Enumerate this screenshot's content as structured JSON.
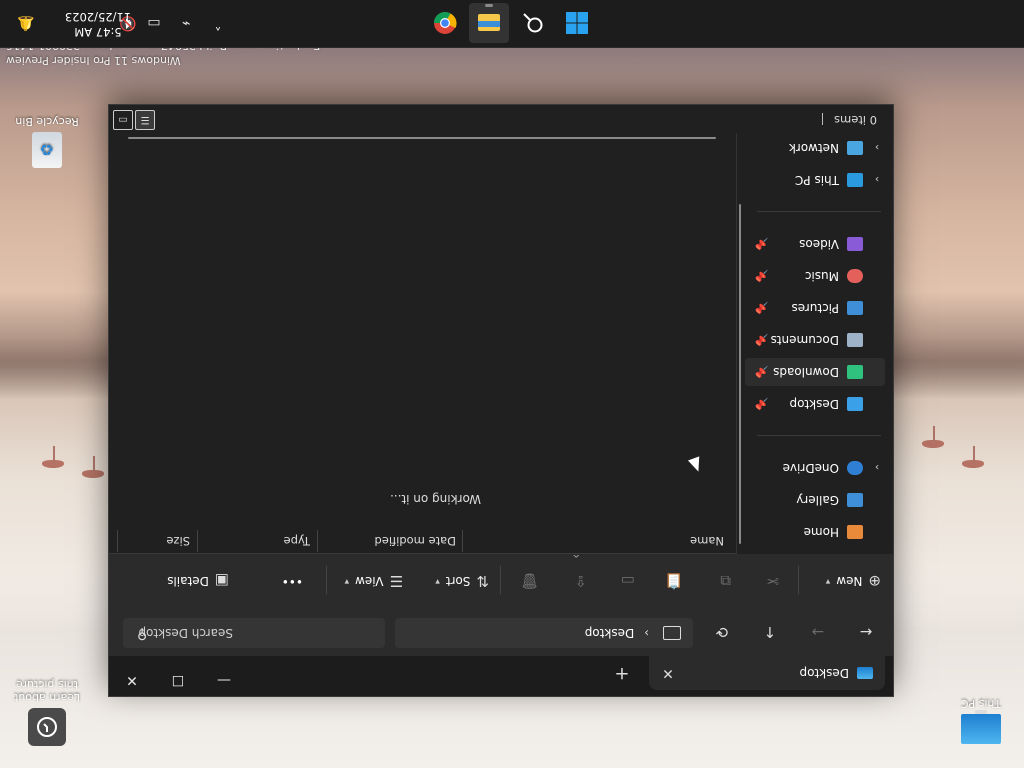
{
  "taskbar": {
    "apps": [
      {
        "name": "Start",
        "icon": "windows-start-icon"
      },
      {
        "name": "Search",
        "icon": "search-icon"
      },
      {
        "name": "File Explorer",
        "icon": "file-explorer-icon",
        "active": true
      },
      {
        "name": "Google Chrome",
        "icon": "chrome-icon"
      }
    ],
    "tray_icons": [
      "chevron-up-icon",
      "network-off-icon",
      "display-icon",
      "volume-mute-icon"
    ],
    "time": "5:47 AM",
    "date": "11/25/2023",
    "notification_icon": "bell-icon"
  },
  "desktop": {
    "icons": [
      {
        "label": "This PC",
        "icon": "this-pc-icon"
      },
      {
        "label": "Learn about this picture",
        "icon": "learn-about-picture-icon"
      },
      {
        "label": "Recycle Bin",
        "icon": "recycle-bin-icon"
      }
    ],
    "watermark": {
      "line1": "Windows 11 Pro Insider Preview",
      "line2": "Evaluation copy. Build 25947.rs_prerelease.230901-1416"
    }
  },
  "explorer": {
    "tab": {
      "title": "Desktop",
      "icon": "desktop-folder-icon",
      "close_glyph": "✕"
    },
    "new_tab_glyph": "+",
    "window_controls": {
      "minimize": "—",
      "maximize": "☐",
      "close": "✕"
    },
    "nav": {
      "back": "←",
      "forward": "→",
      "up": "↑",
      "refresh": "⟳"
    },
    "address": {
      "crumb_separator": "›",
      "crumb": "Desktop"
    },
    "search": {
      "placeholder": "Search Desktop",
      "icon_glyph": "⚲"
    },
    "toolbar": {
      "new_label": "New",
      "sort_label": "Sort",
      "view_label": "View",
      "more_label": "•••",
      "details_label": "Details"
    },
    "nav_pane": {
      "home": "Home",
      "gallery": "Gallery",
      "onedrive": "OneDrive",
      "quick_access": [
        {
          "label": "Desktop",
          "color": "#3aa0e8"
        },
        {
          "label": "Downloads",
          "color": "#2ec27e",
          "selected": true
        },
        {
          "label": "Documents",
          "color": "#9fb3c8"
        },
        {
          "label": "Pictures",
          "color": "#3e8fd8"
        },
        {
          "label": "Music",
          "color": "#e4605a"
        },
        {
          "label": "Videos",
          "color": "#8a5bd6"
        }
      ],
      "this_pc": "This PC",
      "network": "Network"
    },
    "columns": {
      "name": "Name",
      "date_modified": "Date modified",
      "type": "Type",
      "size": "Size"
    },
    "content": {
      "status_message": "Working on it..."
    },
    "statusbar": {
      "items": "0 items"
    }
  }
}
